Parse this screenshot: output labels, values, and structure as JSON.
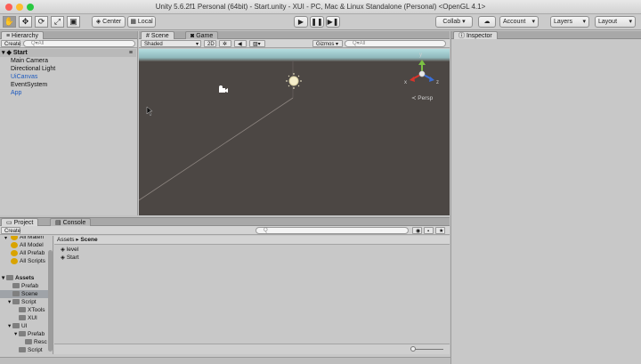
{
  "window": {
    "title": "Unity 5.6.2f1 Personal (64bit) - Start.unity - XUI - PC, Mac & Linux Standalone (Personal) <OpenGL 4.1>"
  },
  "colors": {
    "close": "#fc5f57",
    "minimize": "#fdbc2e",
    "maximize": "#28c840",
    "scene_bg": "#4c4744",
    "sky": "#a6d3d8",
    "blue_text": "#1f5bbf",
    "gizmo_y": "#7bc043",
    "gizmo_x": "#d9342b",
    "gizmo_z": "#3a6fd8"
  },
  "toolbar": {
    "tools": [
      {
        "icon": "hand-icon",
        "glyph": "✋"
      },
      {
        "icon": "move-icon",
        "glyph": "✥"
      },
      {
        "icon": "rotate-icon",
        "glyph": "⟳"
      },
      {
        "icon": "scale-icon",
        "glyph": "⤢"
      },
      {
        "icon": "rect-icon",
        "glyph": "▣"
      }
    ],
    "center": "Center",
    "local": "Local",
    "collab": "Collab ▾",
    "account": "Account",
    "layers": "Layers",
    "layout": "Layout"
  },
  "hierarchy": {
    "tab": "Hierarchy",
    "create": "Create ▾",
    "search_placeholder": "Q▾All",
    "scene": "Start",
    "items": [
      {
        "label": "Main Camera",
        "blue": false
      },
      {
        "label": "Directional Light",
        "blue": false
      },
      {
        "label": "UiCanvas",
        "blue": true
      },
      {
        "label": "EventSystem",
        "blue": false
      },
      {
        "label": "App",
        "blue": true
      }
    ]
  },
  "scene": {
    "tab_scene": "Scene",
    "tab_game": "Game",
    "shading": "Shaded",
    "mode_2d": "2D",
    "gizmos": "Gizmos ▾",
    "search_placeholder": "Q▾All",
    "persp": "≺ Persp",
    "axes": {
      "y": "y",
      "x": "x",
      "z": "z"
    }
  },
  "inspector": {
    "tab": "Inspector"
  },
  "project": {
    "tab_project": "Project",
    "tab_console": "Console",
    "create": "Create ▾",
    "favorites": [
      "All Materi",
      "All Model",
      "All Prefab",
      "All Scripts"
    ],
    "tree": [
      {
        "label": "Assets",
        "indent": 0,
        "bold": true
      },
      {
        "label": "Prefab",
        "indent": 1,
        "bold": false
      },
      {
        "label": "Scene",
        "indent": 1,
        "bold": false,
        "selected": true
      },
      {
        "label": "Script",
        "indent": 1,
        "bold": false
      },
      {
        "label": "XTools",
        "indent": 2,
        "bold": false
      },
      {
        "label": "XUI",
        "indent": 2,
        "bold": false
      },
      {
        "label": "UI",
        "indent": 1,
        "bold": false
      },
      {
        "label": "Prefab",
        "indent": 2,
        "bold": false
      },
      {
        "label": "Resc",
        "indent": 3,
        "bold": false
      },
      {
        "label": "Script",
        "indent": 2,
        "bold": false
      }
    ],
    "breadcrumb": {
      "root": "Assets",
      "sep": "▸",
      "current": "Scene"
    },
    "files": [
      "level",
      "Start"
    ]
  }
}
